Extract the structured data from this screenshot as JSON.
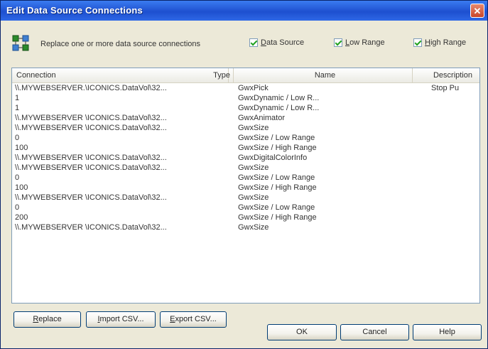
{
  "window": {
    "title": "Edit Data Source Connections",
    "close_symbol": "✕"
  },
  "toolbar": {
    "icon": "data-source-icon",
    "label": "Replace one or more data source connections",
    "checks": [
      {
        "label_accel": "D",
        "label_rest": "ata Source",
        "checked": true
      },
      {
        "label_accel": "L",
        "label_rest": "ow Range",
        "checked": true
      },
      {
        "label_accel": "H",
        "label_rest": "igh Range",
        "checked": true
      }
    ]
  },
  "list": {
    "headers": {
      "connection": "Connection",
      "type": "Type",
      "name": "Name",
      "description": "Description"
    },
    "rows": [
      {
        "connection": "\\\\.MYWEBSERVER.\\ICONICS.DataVol\\32...",
        "name": "GwxPick",
        "description": "Stop Pu"
      },
      {
        "connection": "1",
        "name": "GwxDynamic / Low R...",
        "description": ""
      },
      {
        "connection": "1",
        "name": "GwxDynamic / Low R...",
        "description": ""
      },
      {
        "connection": "\\\\.MYWEBSERVER \\ICONICS.DataVol\\32...",
        "name": "GwxAnimator",
        "description": ""
      },
      {
        "connection": "\\\\.MYWEBSERVER \\ICONICS.DataVol\\32...",
        "name": "GwxSize",
        "description": ""
      },
      {
        "connection": "0",
        "name": "GwxSize / Low Range",
        "description": ""
      },
      {
        "connection": "100",
        "name": "GwxSize / High Range",
        "description": ""
      },
      {
        "connection": "\\\\.MYWEBSERVER \\ICONICS.DataVol\\32...",
        "name": "GwxDigitalColorInfo",
        "description": ""
      },
      {
        "connection": "\\\\.MYWEBSERVER \\ICONICS.DataVol\\32...",
        "name": "GwxSize",
        "description": ""
      },
      {
        "connection": "0",
        "name": "GwxSize / Low Range",
        "description": ""
      },
      {
        "connection": "100",
        "name": "GwxSize / High Range",
        "description": ""
      },
      {
        "connection": "\\\\.MYWEBSERVER \\ICONICS.DataVol\\32...",
        "name": "GwxSize",
        "description": ""
      },
      {
        "connection": "0",
        "name": "GwxSize / Low Range",
        "description": ""
      },
      {
        "connection": "200",
        "name": "GwxSize / High Range",
        "description": ""
      },
      {
        "connection": "\\\\.MYWEBSERVER \\ICONICS.DataVol\\32...",
        "name": "GwxSize",
        "description": ""
      }
    ]
  },
  "buttons": {
    "replace": {
      "accel": "R",
      "rest": "eplace"
    },
    "import": {
      "accel": "I",
      "rest": "mport CSV..."
    },
    "export": {
      "accel": "E",
      "rest": "xport CSV..."
    },
    "ok": "OK",
    "cancel": "Cancel",
    "help": "Help"
  }
}
